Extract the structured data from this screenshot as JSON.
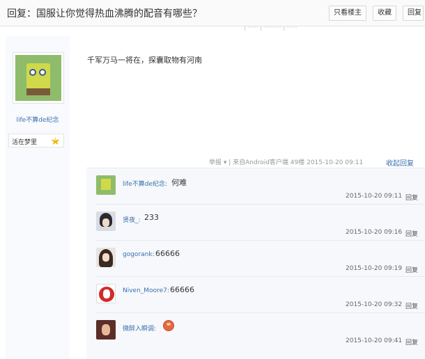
{
  "header": {
    "title": "回复：国服让你觉得热血沸腾的配音有哪些？",
    "buttons": [
      "只看楼主",
      "收藏",
      "回复"
    ]
  },
  "post": {
    "author": {
      "name": "life不算de纪念",
      "rank_title": "活在梦里",
      "rank_level": "9"
    },
    "content": "千军万马一将在，探囊取物有河南",
    "meta": "举报 ▾ | 来自Android客户端  49楼  2015-10-20 09:11",
    "fold_label": "收起回复"
  },
  "replies": [
    {
      "name": "life不算de纪念:",
      "content": "何难",
      "time": "2015-10-20 09:11",
      "reply_label": "回复",
      "avatar_icon": "spongebob-avatar-icon"
    },
    {
      "name": "贤夜_:",
      "content": "233",
      "time": "2015-10-20 09:16",
      "reply_label": "回复",
      "avatar_icon": "anime-boy-avatar-icon"
    },
    {
      "name": "gogorank:",
      "content": "66666",
      "time": "2015-10-20 09:19",
      "reply_label": "回复",
      "avatar_icon": "anime-girl-avatar-icon"
    },
    {
      "name": "Niven_Moore7:",
      "content": "66666",
      "time": "2015-10-20 09:32",
      "reply_label": "回复",
      "avatar_icon": "kfc-avatar-icon"
    },
    {
      "name": "微醉入瞬调:",
      "content": "",
      "time": "2015-10-20 09:41",
      "reply_label": "回复",
      "avatar_icon": "girl-photo-avatar-icon"
    }
  ]
}
